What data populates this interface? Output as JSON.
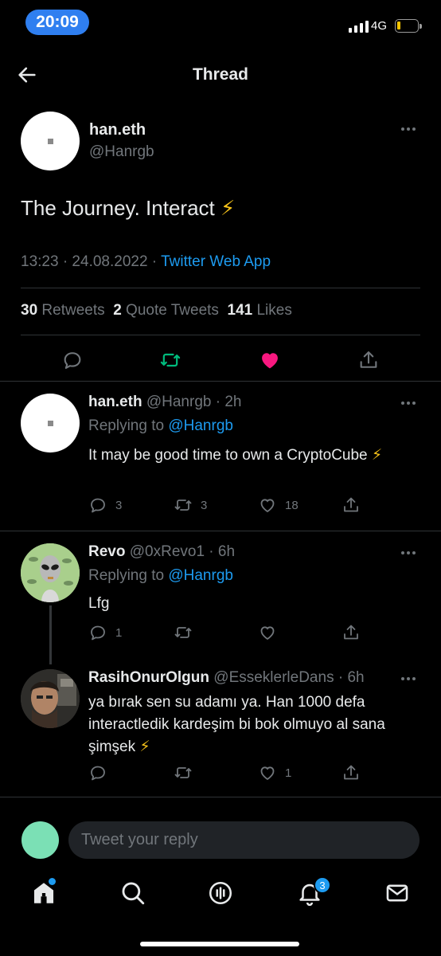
{
  "status_bar": {
    "time": "20:09",
    "network": "4G"
  },
  "header": {
    "title": "Thread"
  },
  "main_tweet": {
    "name": "han.eth",
    "handle": "@Hanrgb",
    "text": "The Journey. Interact",
    "emoji": "⚡",
    "time": "13:23 · 24.08.2022 ·",
    "source": "Twitter Web App",
    "retweets_count": "30",
    "retweets_label": "Retweets",
    "quotes_count": "2",
    "quotes_label": "Quote Tweets",
    "likes_count": "141",
    "likes_label": "Likes"
  },
  "replies": [
    {
      "name": "han.eth",
      "handle": "@Hanrgb · 2h",
      "replying_label": "Replying to",
      "replying_to": "@Hanrgb",
      "text": "It may be good time to own a CryptoCube ⚡",
      "reply_count": "3",
      "retweet_count": "3",
      "like_count": "18"
    },
    {
      "name": "Revo",
      "handle": "@0xRevo1 · 6h",
      "replying_label": "Replying to",
      "replying_to": "@Hanrgb",
      "text": "Lfg",
      "reply_count": "1",
      "retweet_count": "",
      "like_count": ""
    },
    {
      "name": "RasihOnurOlgun",
      "handle": "@EsseklerleDans · 6h",
      "text": "ya bırak sen su adamı ya. Han 1000 defa interactledik kardeşim bi bok olmuyo al sana şimşek ⚡",
      "reply_count": "",
      "retweet_count": "",
      "like_count": "1"
    }
  ],
  "composer": {
    "placeholder": "Tweet your reply"
  },
  "tabbar": {
    "notifications_badge": "3"
  },
  "colors": {
    "accent": "#1d9bf0",
    "retweet_green": "#00ba7c",
    "like_pink": "#f91880",
    "bolt_yellow": "#f7c31a"
  },
  "icons": [
    "back-arrow-icon",
    "more-icon",
    "reply-icon",
    "retweet-icon",
    "like-icon",
    "share-icon",
    "home-icon",
    "search-icon",
    "spaces-icon",
    "notifications-icon",
    "messages-icon"
  ]
}
